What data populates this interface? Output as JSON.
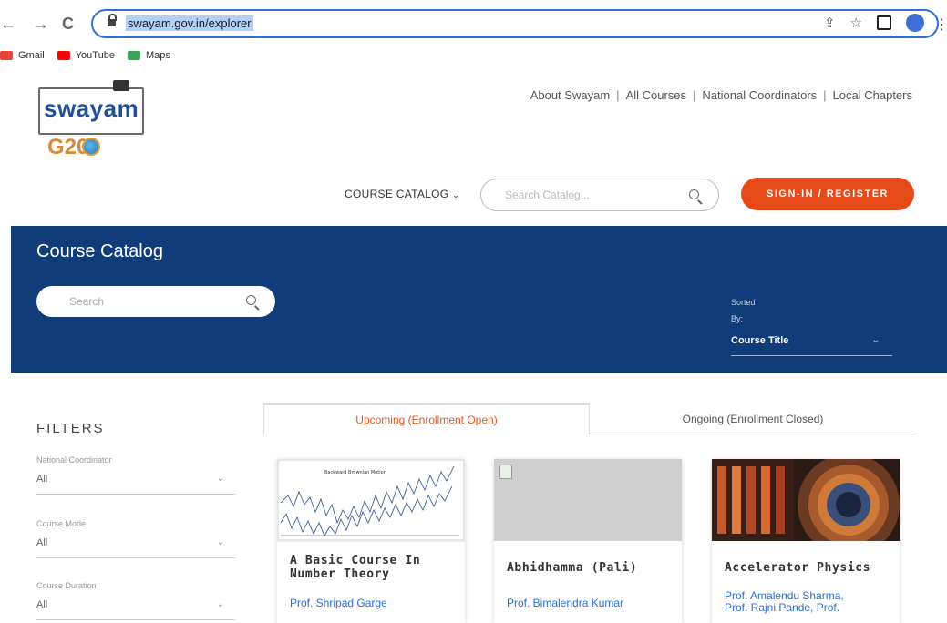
{
  "browser": {
    "url": "swayam.gov.in/explorer",
    "profile_initial": "",
    "bookmarks": [
      {
        "label": "Gmail",
        "color": "#ea4335"
      },
      {
        "label": "YouTube",
        "color": "#ff0000"
      },
      {
        "label": "Maps",
        "color": "#34a853"
      }
    ]
  },
  "header": {
    "logo_text": "swayam",
    "g20_text": "G20",
    "nav": [
      "About Swayam",
      "All Courses",
      "National Coordinators",
      "Local Chapters"
    ],
    "course_catalog_label": "COURSE CATALOG",
    "search_placeholder": "Search Catalog...",
    "signin_label": "SIGN-IN / REGISTER"
  },
  "band": {
    "title": "Course Catalog",
    "search_placeholder": "Search",
    "sorted_label_1": "Sorted",
    "sorted_label_2": "By:",
    "sort_value": "Course Title"
  },
  "filters": {
    "title": "FILTERS",
    "items": [
      {
        "label": "National Coordinator",
        "value": "All"
      },
      {
        "label": "Course Mode",
        "value": "All"
      },
      {
        "label": "Course Duration",
        "value": "All"
      }
    ]
  },
  "tabs": {
    "active": "Upcoming (Enrollment Open)",
    "inactive": "Ongoing (Enrollment Closed)"
  },
  "cards": [
    {
      "title_line1": "A Basic Course In",
      "title_line2": "Number Theory",
      "prof": "Prof. Shripad Garge",
      "chart_label": "Backward Brownian Motion"
    },
    {
      "title_line1": "Abhidhamma (Pali)",
      "title_line2": "",
      "prof": "Prof. Bimalendra Kumar"
    },
    {
      "title_line1": "Accelerator Physics",
      "title_line2": "",
      "prof_line1": "Prof. Amalendu Sharma,",
      "prof_line2": "Prof. Rajni Pande, Prof."
    }
  ],
  "colors": {
    "accent_orange": "#e64a19",
    "band_blue": "#113c7a",
    "link_blue": "#2d6fd1"
  }
}
